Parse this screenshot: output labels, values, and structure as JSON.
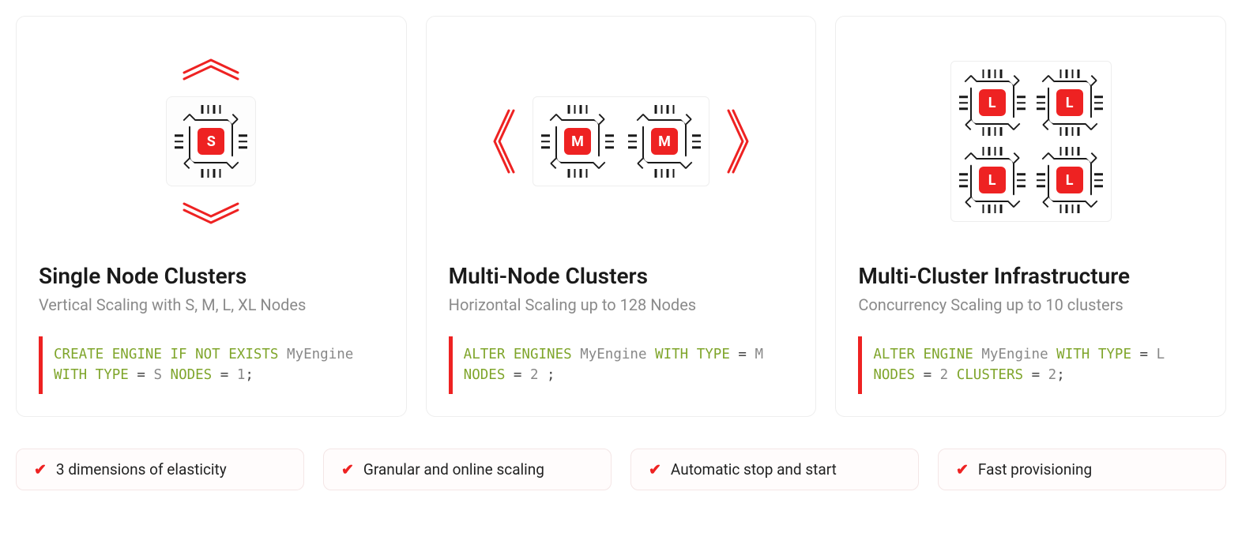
{
  "cards": [
    {
      "title": "Single Node Clusters",
      "subtitle": "Vertical Scaling with S, M, L, XL Nodes",
      "chip_label": "S",
      "code_tokens": [
        {
          "t": "CREATE ENGINE IF NOT EXISTS",
          "c": "kw"
        },
        {
          "t": " ",
          "c": ""
        },
        {
          "t": "MyEngine",
          "c": "id"
        },
        {
          "t": " ",
          "c": ""
        },
        {
          "t": "WITH TYPE",
          "c": "kw"
        },
        {
          "t": " = ",
          "c": ""
        },
        {
          "t": "S",
          "c": "id"
        },
        {
          "t": " ",
          "c": ""
        },
        {
          "t": "NODES",
          "c": "kw"
        },
        {
          "t": " = ",
          "c": ""
        },
        {
          "t": "1",
          "c": "id"
        },
        {
          "t": ";",
          "c": ""
        }
      ]
    },
    {
      "title": "Multi-Node Clusters",
      "subtitle": "Horizontal Scaling up to 128 Nodes",
      "chip_label": "M",
      "code_tokens": [
        {
          "t": "ALTER ENGINES",
          "c": "kw"
        },
        {
          "t": " ",
          "c": ""
        },
        {
          "t": "MyEngine",
          "c": "id"
        },
        {
          "t": " ",
          "c": ""
        },
        {
          "t": "WITH TYPE",
          "c": "kw"
        },
        {
          "t": " = ",
          "c": ""
        },
        {
          "t": "M",
          "c": "id"
        },
        {
          "t": " ",
          "c": ""
        },
        {
          "t": "NODES",
          "c": "kw"
        },
        {
          "t": " = ",
          "c": ""
        },
        {
          "t": "2",
          "c": "id"
        },
        {
          "t": " ;",
          "c": ""
        }
      ]
    },
    {
      "title": "Multi-Cluster Infrastructure",
      "subtitle": "Concurrency Scaling up to 10 clusters",
      "chip_label": "L",
      "code_tokens": [
        {
          "t": "ALTER ENGINE",
          "c": "kw"
        },
        {
          "t": " ",
          "c": ""
        },
        {
          "t": "MyEngine",
          "c": "id"
        },
        {
          "t": " ",
          "c": ""
        },
        {
          "t": "WITH TYPE",
          "c": "kw"
        },
        {
          "t": " = ",
          "c": ""
        },
        {
          "t": "L",
          "c": "id"
        },
        {
          "t": " ",
          "c": ""
        },
        {
          "t": "NODES",
          "c": "kw"
        },
        {
          "t": " = ",
          "c": ""
        },
        {
          "t": "2",
          "c": "id"
        },
        {
          "t": " ",
          "c": ""
        },
        {
          "t": "CLUSTERS",
          "c": "kw"
        },
        {
          "t": " = ",
          "c": ""
        },
        {
          "t": "2",
          "c": "id"
        },
        {
          "t": ";",
          "c": ""
        }
      ]
    }
  ],
  "pills": [
    "3 dimensions of elasticity",
    "Granular and online scaling",
    "Automatic stop and start",
    "Fast provisioning"
  ]
}
